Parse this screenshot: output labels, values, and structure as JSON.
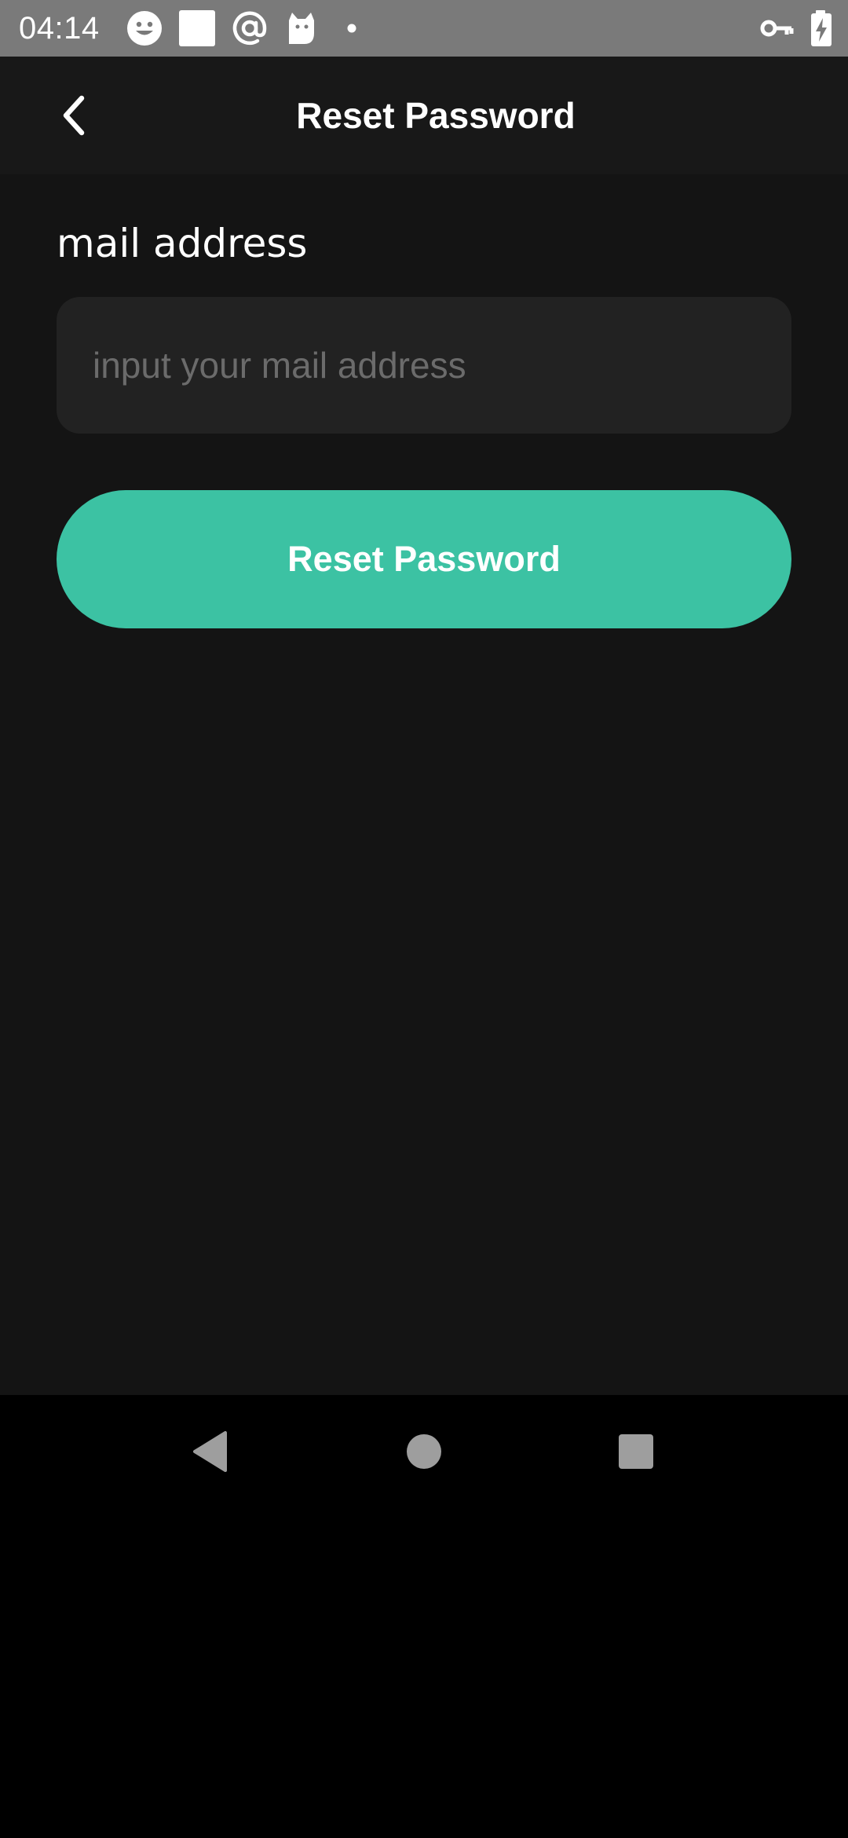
{
  "status_bar": {
    "time": "04:14",
    "icons": [
      "smiley-icon",
      "white-square-icon",
      "at-sign-icon",
      "cat-icon",
      "dot-icon",
      "vpn-key-icon",
      "battery-charging-icon"
    ]
  },
  "header": {
    "title": "Reset Password",
    "back_icon": "chevron-left-icon"
  },
  "form": {
    "email_label": "mail address",
    "email_value": "",
    "email_placeholder": "input your mail address",
    "submit_label": "Reset Password"
  },
  "nav_bar": {
    "icons": [
      "nav-back-triangle-icon",
      "nav-home-circle-icon",
      "nav-recents-square-icon"
    ]
  },
  "colors": {
    "status_bar_bg": "#7a7a7a",
    "app_bg": "#141414",
    "app_bar_bg": "#181818",
    "input_bg": "#222222",
    "accent": "#3cc2a3",
    "placeholder": "#6b6b6b",
    "nav_icon": "#9e9e9e"
  }
}
